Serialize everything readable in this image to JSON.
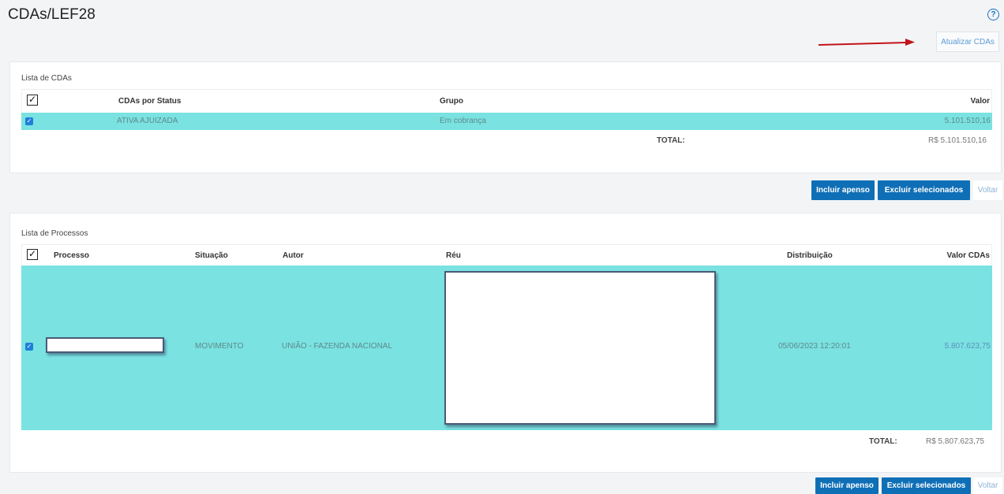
{
  "page": {
    "title": "CDAs/LEF28",
    "help_icon": "help-icon",
    "help_glyph": "?",
    "refresh_button": "Atualizar CDAs"
  },
  "cdas": {
    "panel_label": "Lista de CDAs",
    "columns": [
      "CDAs por Status",
      "Grupo",
      "Valor"
    ],
    "rows": [
      {
        "status": "ATIVA AJUIZADA",
        "grupo": "Em cobrança",
        "valor": "5.101.510,16",
        "checked": true
      }
    ],
    "total_label": "TOTAL:",
    "total_value": "R$ 5.101.510,16",
    "actions": {
      "include": "Incluir apenso",
      "delete": "Excluir selecionados",
      "back": "Voltar"
    }
  },
  "processos": {
    "panel_label": "Lista de Processos",
    "columns": [
      "Processo",
      "Situação",
      "Autor",
      "Réu",
      "Distribuição",
      "Valor CDAs"
    ],
    "rows": [
      {
        "processo": "",
        "situacao": "MOVIMENTO",
        "autor": "UNIÃO - FAZENDA NACIONAL",
        "reu": "",
        "distribuicao": "05/06/2023 12:20:01",
        "valor": "5.807.623,75",
        "checked": true
      }
    ],
    "total_label": "TOTAL:",
    "total_value": "R$ 5.807.623,75",
    "actions": {
      "include": "Incluir apenso",
      "delete": "Excluir selecionados",
      "back": "Voltar"
    }
  },
  "colors": {
    "row_highlight": "#7ae2e1",
    "primary": "#0f6fb6",
    "annotation_arrow": "#c0141a"
  }
}
